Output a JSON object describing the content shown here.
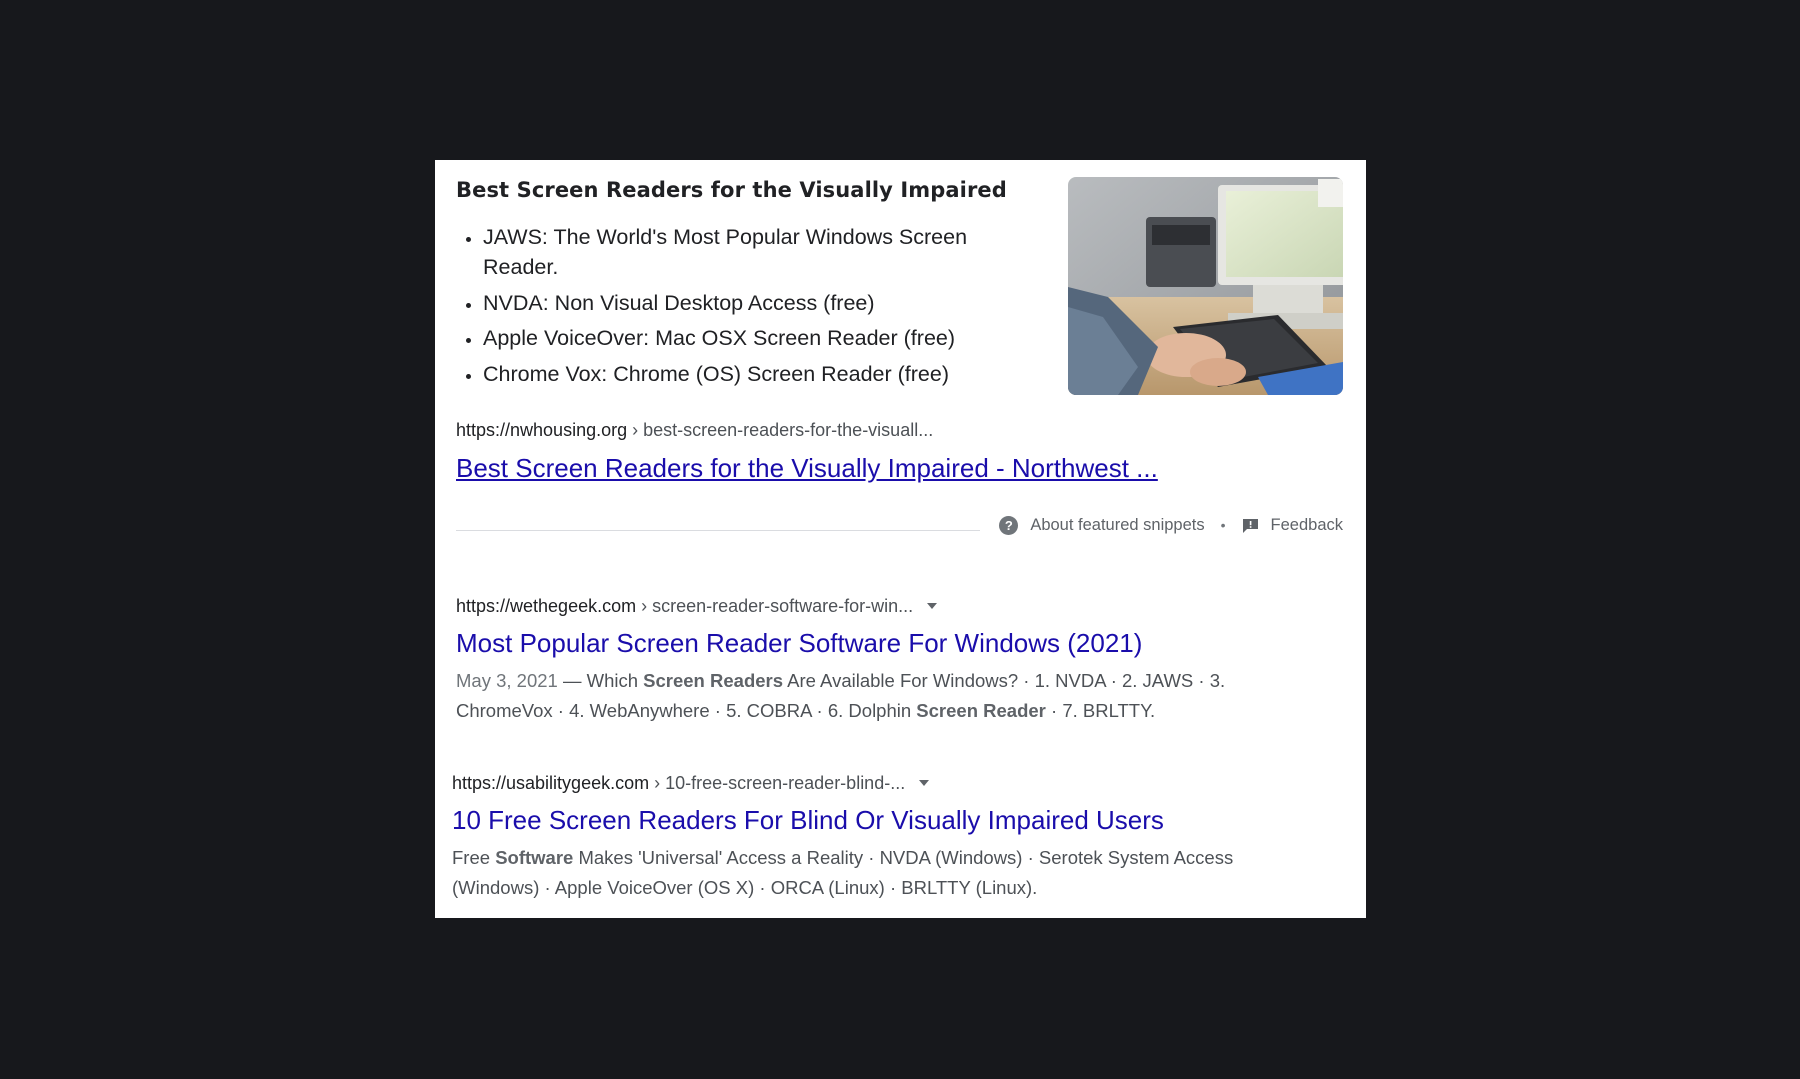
{
  "featured_snippet": {
    "title": "Best Screen Readers for the Visually Impaired",
    "items": [
      "JAWS: The World's Most Popular Windows Screen Reader.",
      "NVDA: Non Visual Desktop Access (free)",
      "Apple VoiceOver: Mac OSX Screen Reader (free)",
      "Chrome Vox: Chrome (OS) Screen Reader (free)"
    ],
    "cite_domain": "https://nwhousing.org",
    "cite_path": " › best-screen-readers-for-the-visuall...",
    "link_text": "Best Screen Readers for the Visually Impaired - Northwest ...",
    "about_label": "About featured snippets",
    "separator": "•",
    "feedback_label": "Feedback"
  },
  "results": [
    {
      "cite_domain": "https://wethegeek.com",
      "cite_path": " › screen-reader-software-for-win...",
      "title": "Most Popular Screen Reader Software For Windows (2021)",
      "snippet": {
        "date": "May 3, 2021",
        "dash": " — ",
        "text1": "Which ",
        "bold1": "Screen Readers",
        "text2": " Are Available For Windows? · 1. NVDA · 2. JAWS · 3. ChromeVox · 4. WebAnywhere · 5. COBRA · 6. Dolphin ",
        "bold2": "Screen Reader",
        "text3": " · 7. BRLTTY."
      }
    },
    {
      "cite_domain": "https://usabilitygeek.com",
      "cite_path": " › 10-free-screen-reader-blind-...",
      "title": "10 Free Screen Readers For Blind Or Visually Impaired Users",
      "snippet": {
        "text1": "Free ",
        "bold1": "Software",
        "text2": " Makes 'Universal' Access a Reality · NVDA (Windows) · Serotek System Access (Windows) · Apple VoiceOver (OS X) · ORCA (Linux) · BRLTTY (Linux)."
      }
    }
  ],
  "icons": {
    "help": "help-circle-icon",
    "feedback": "feedback-icon",
    "dropdown": "chevron-down-icon"
  },
  "colors": {
    "background": "#17181c",
    "card": "#ffffff",
    "link": "#1a0dab",
    "text": "#202124",
    "muted": "#4d5156"
  }
}
